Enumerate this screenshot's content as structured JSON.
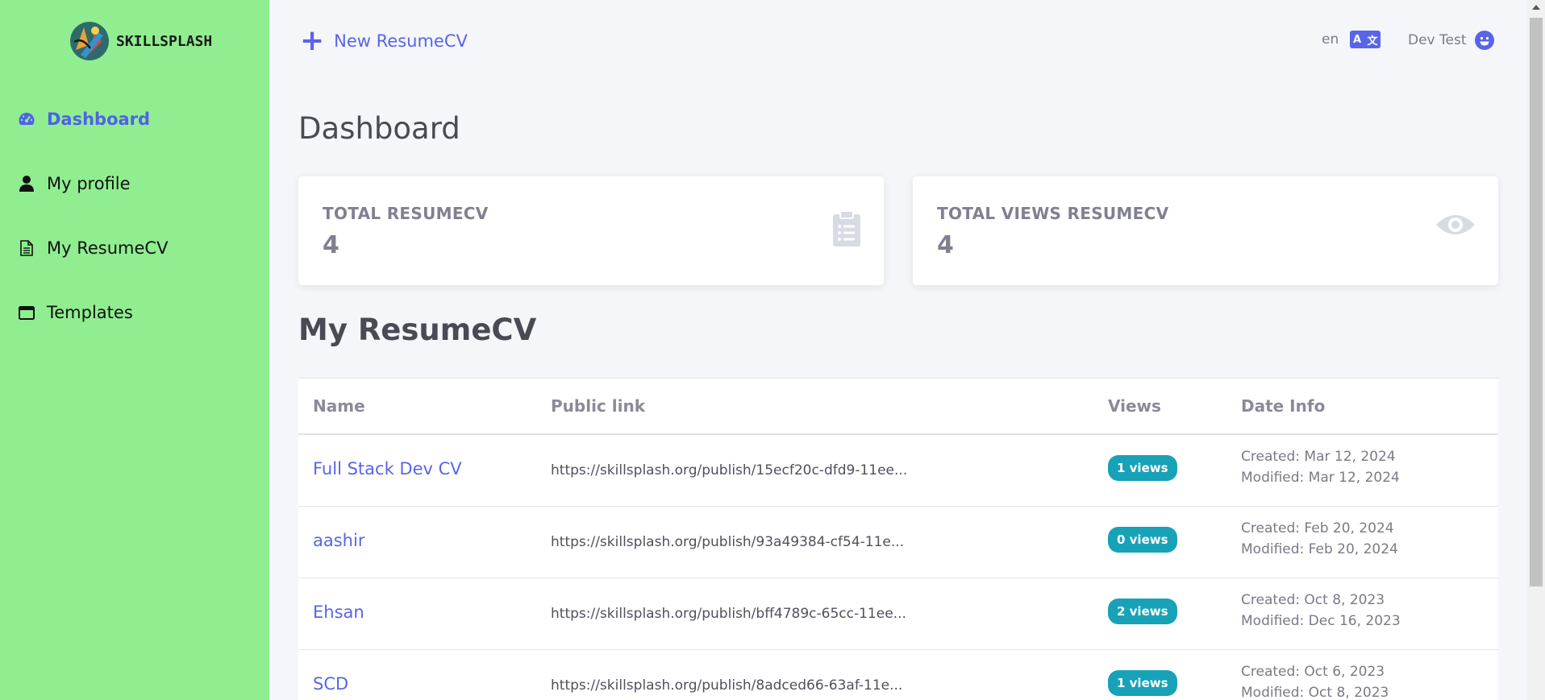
{
  "brand": {
    "name": "SKILLSPLASH"
  },
  "sidebar": {
    "items": [
      {
        "label": "Dashboard",
        "icon": "dashboard-icon",
        "active": true
      },
      {
        "label": "My profile",
        "icon": "user-icon"
      },
      {
        "label": "My ResumeCV",
        "icon": "document-icon"
      },
      {
        "label": "Templates",
        "icon": "window-icon"
      }
    ]
  },
  "header": {
    "new_button": "New ResumeCV",
    "language": "en",
    "user_name": "Dev Test"
  },
  "page": {
    "title": "Dashboard",
    "section_title": "My ResumeCV"
  },
  "stats": [
    {
      "label": "TOTAL RESUMECV",
      "value": "4",
      "icon": "clipboard-list-icon"
    },
    {
      "label": "TOTAL VIEWS RESUMECV",
      "value": "4",
      "icon": "eye-icon"
    }
  ],
  "table": {
    "headers": [
      "Name",
      "Public link",
      "Views",
      "Date Info"
    ],
    "rows": [
      {
        "name": "Full Stack Dev CV",
        "link": "https://skillsplash.org/publish/15ecf20c-dfd9-11ee...",
        "views": "1 views",
        "created": "Created: Mar 12, 2024",
        "modified": "Modified: Mar 12, 2024"
      },
      {
        "name": "aashir",
        "link": "https://skillsplash.org/publish/93a49384-cf54-11e...",
        "views": "0 views",
        "created": "Created: Feb 20, 2024",
        "modified": "Modified: Feb 20, 2024"
      },
      {
        "name": "Ehsan",
        "link": "https://skillsplash.org/publish/bff4789c-65cc-11ee...",
        "views": "2 views",
        "created": "Created: Oct 8, 2023",
        "modified": "Modified: Dec 16, 2023"
      },
      {
        "name": "SCD",
        "link": "https://skillsplash.org/publish/8adced66-63af-11e...",
        "views": "1 views",
        "created": "Created: Oct 6, 2023",
        "modified": "Modified: Oct 8, 2023"
      }
    ]
  },
  "colors": {
    "sidebar_bg": "#90ee90",
    "accent": "#5865e8",
    "badge": "#17a2b8",
    "page_bg": "#f5f6fa"
  }
}
